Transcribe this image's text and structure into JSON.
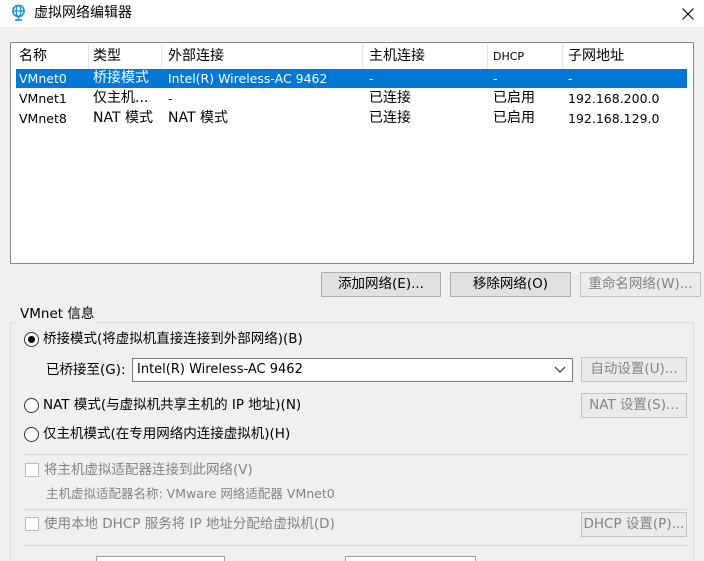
{
  "window": {
    "title": "虚拟网络编辑器",
    "icon": "network-globe-icon",
    "close_icon": "close-icon"
  },
  "table": {
    "headers": [
      "名称",
      "类型",
      "外部连接",
      "主机连接",
      "DHCP",
      "子网地址"
    ],
    "rows": [
      {
        "name": "VMnet0",
        "type": "桥接模式",
        "external": "Intel(R) Wireless-AC 9462",
        "host": "-",
        "dhcp": "-",
        "subnet": "-",
        "selected": true
      },
      {
        "name": "VMnet1",
        "type": "仅主机...",
        "external": "-",
        "host": "已连接",
        "dhcp": "已启用",
        "subnet": "192.168.200.0",
        "selected": false
      },
      {
        "name": "VMnet8",
        "type": "NAT 模式",
        "external": "NAT 模式",
        "host": "已连接",
        "dhcp": "已启用",
        "subnet": "192.168.129.0",
        "selected": false
      }
    ]
  },
  "buttons": {
    "add": "添加网络(E)...",
    "remove": "移除网络(O)",
    "rename": "重命名网络(W)..."
  },
  "vmnet_info": {
    "title": "VMnet 信息",
    "bridged_label": "桥接模式(将虚拟机直接连接到外部网络)(B)",
    "bridged_selected": true,
    "bridged_to_label": "已桥接至(G):",
    "bridged_to_value": "Intel(R) Wireless-AC 9462",
    "auto_settings": "自动设置(U)...",
    "nat_label": "NAT 模式(与虚拟机共享主机的 IP 地址)(N)",
    "nat_settings": "NAT 设置(S)...",
    "hostonly_label": "仅主机模式(在专用网络内连接虚拟机)(H)",
    "connect_adapter_label": "将主机虚拟适配器连接到此网络(V)",
    "adapter_name_text": "主机虚拟适配器名称: VMware 网络适配器 VMnet0",
    "dhcp_label": "使用本地 DHCP 服务将 IP 地址分配给虚拟机(D)",
    "dhcp_settings": "DHCP 设置(P)..."
  },
  "colors": {
    "selection": "#0078d7",
    "window_bg": "#f0f0f0",
    "title_icon": "#1e90d6"
  }
}
